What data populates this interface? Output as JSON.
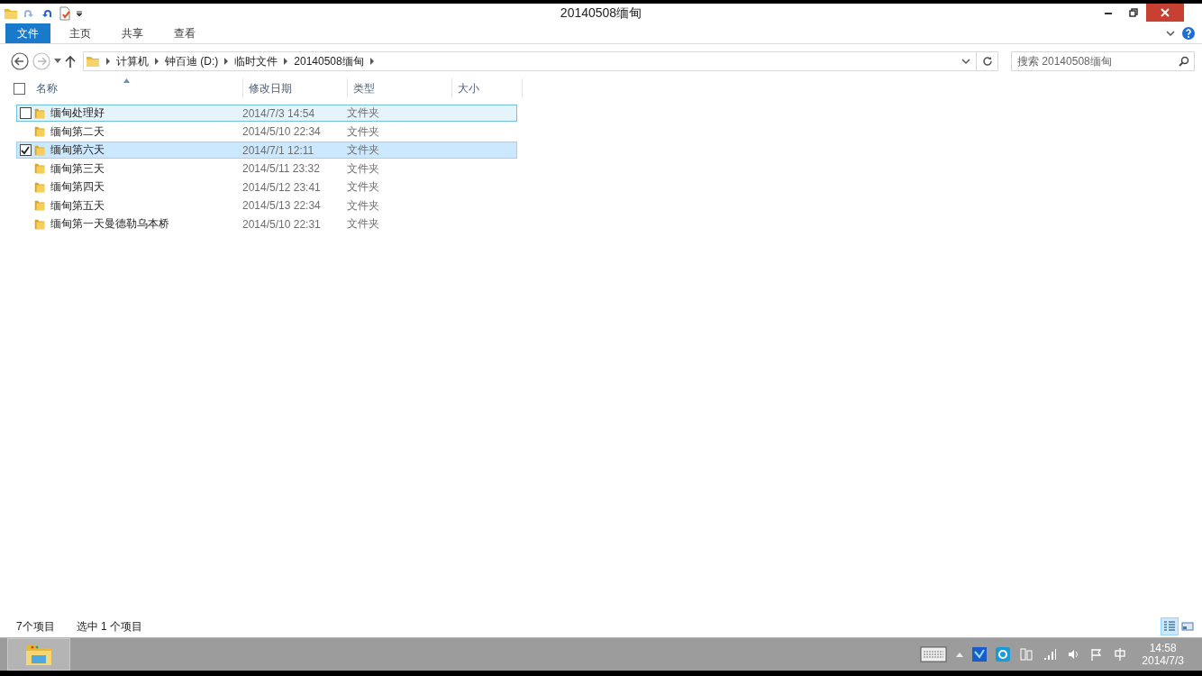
{
  "window": {
    "title": "20140508缅甸"
  },
  "ribbon_tabs": [
    {
      "label": "文件",
      "selected": true
    },
    {
      "label": "主页",
      "selected": false
    },
    {
      "label": "共享",
      "selected": false
    },
    {
      "label": "查看",
      "selected": false
    }
  ],
  "breadcrumb": [
    "计算机",
    "钟百迪 (D:)",
    "临时文件",
    "20140508缅甸"
  ],
  "search": {
    "placeholder": "搜索 20140508缅甸"
  },
  "select_all": {
    "checked": false
  },
  "columns": [
    "名称",
    "修改日期",
    "类型",
    "大小"
  ],
  "rows": [
    {
      "name": "缅甸处理好",
      "date": "2014/7/3 14:54",
      "type": "文件夹",
      "selected": false,
      "hovered": true
    },
    {
      "name": "缅甸第二天",
      "date": "2014/5/10 22:34",
      "type": "文件夹",
      "selected": false,
      "hovered": false
    },
    {
      "name": "缅甸第六天",
      "date": "2014/7/1 12:11",
      "type": "文件夹",
      "selected": true,
      "hovered": false
    },
    {
      "name": "缅甸第三天",
      "date": "2014/5/11 23:32",
      "type": "文件夹",
      "selected": false,
      "hovered": false
    },
    {
      "name": "缅甸第四天",
      "date": "2014/5/12 23:41",
      "type": "文件夹",
      "selected": false,
      "hovered": false
    },
    {
      "name": "缅甸第五天",
      "date": "2014/5/13 22:34",
      "type": "文件夹",
      "selected": false,
      "hovered": false
    },
    {
      "name": "缅甸第一天曼德勒乌本桥",
      "date": "2014/5/10 22:31",
      "type": "文件夹",
      "selected": false,
      "hovered": false
    }
  ],
  "status_bar": {
    "count": "7个项目",
    "selection": "选中 1 个项目"
  },
  "view_buttons": [
    {
      "kind": "details",
      "selected": true
    },
    {
      "kind": "tiles",
      "selected": false
    }
  ],
  "taskbar": {
    "time": "14:58",
    "date": "2014/7/3"
  }
}
